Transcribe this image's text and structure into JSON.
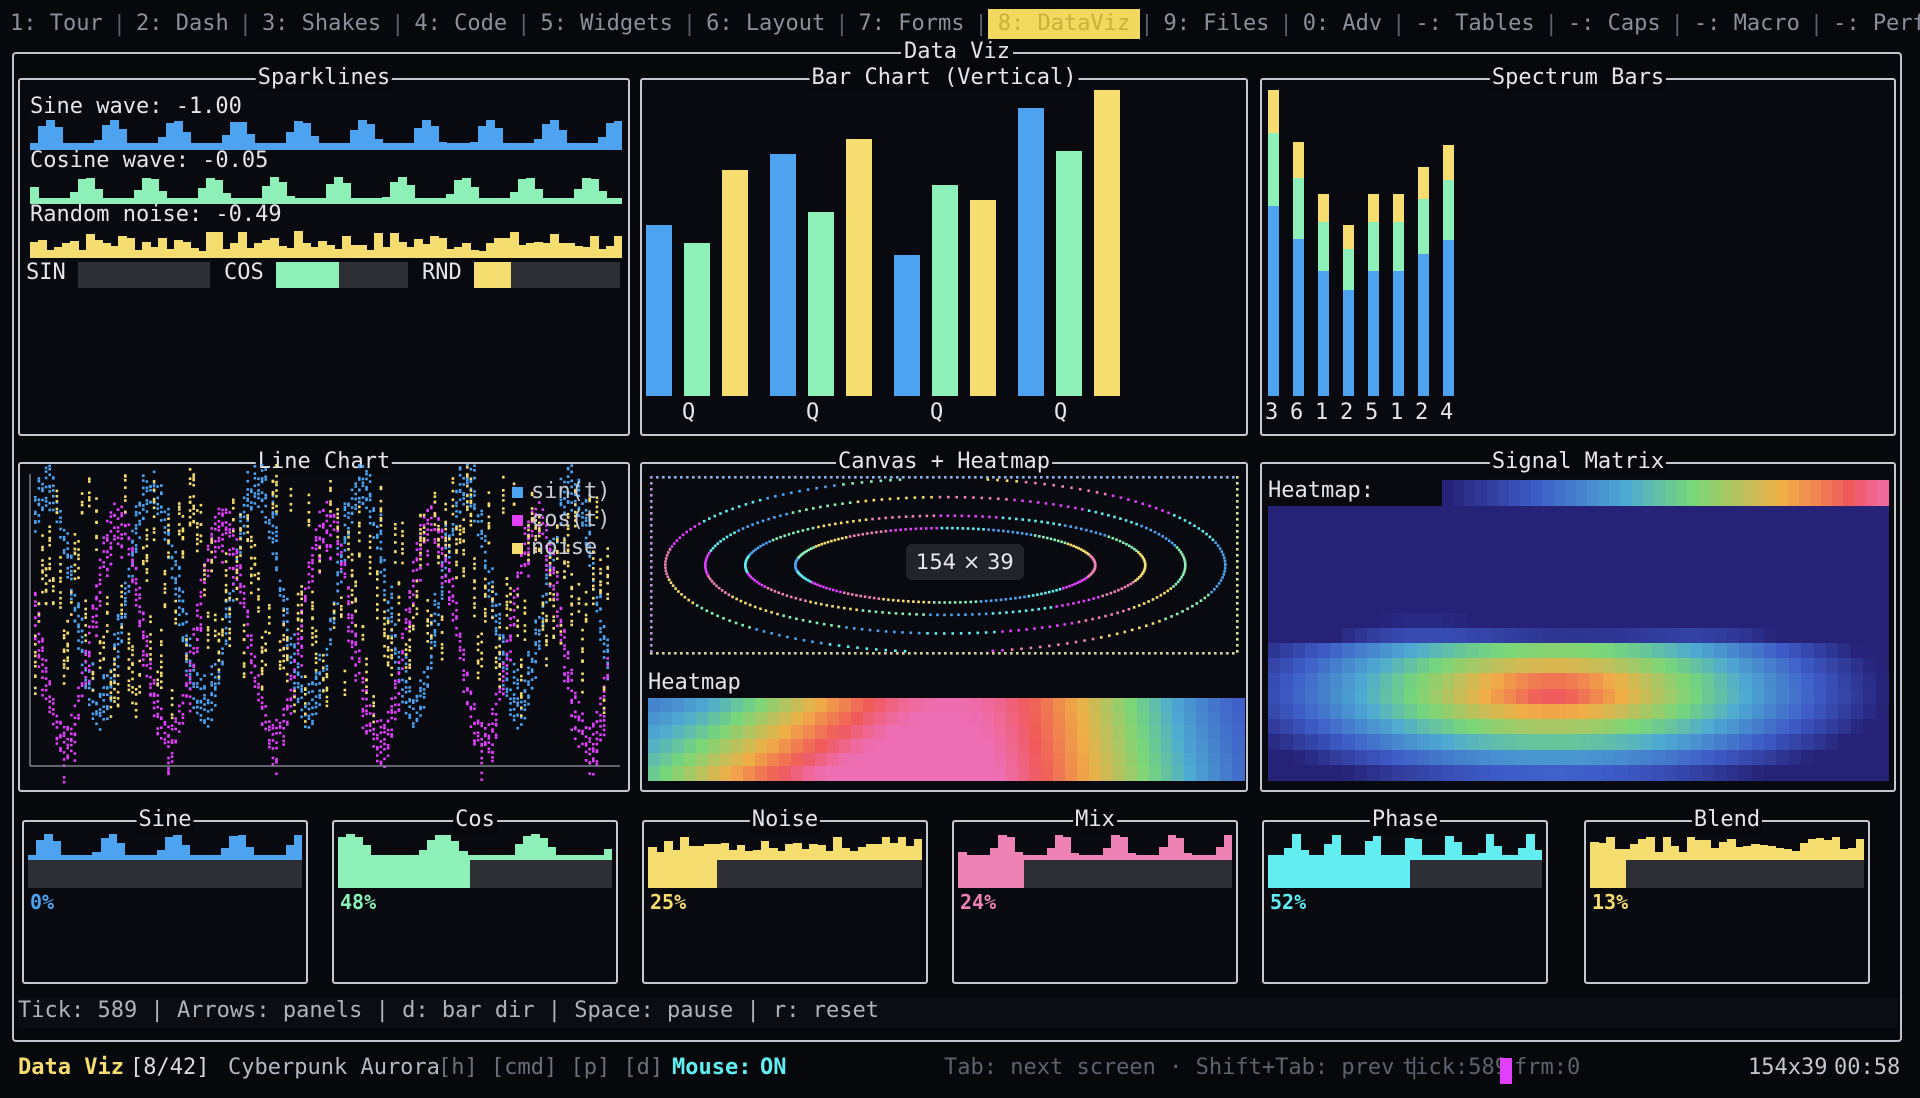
{
  "tabs": [
    {
      "label": "1: Tour",
      "active": false
    },
    {
      "label": "2: Dash",
      "active": false
    },
    {
      "label": "3: Shakes",
      "active": false
    },
    {
      "label": "4: Code",
      "active": false
    },
    {
      "label": "5: Widgets",
      "active": false
    },
    {
      "label": "6: Layout",
      "active": false
    },
    {
      "label": "7: Forms",
      "active": false
    },
    {
      "label": "8: DataViz",
      "active": true
    },
    {
      "label": "9: Files",
      "active": false
    },
    {
      "label": "0: Adv",
      "active": false
    },
    {
      "label": "-: Tables",
      "active": false
    },
    {
      "label": "-: Caps",
      "active": false
    },
    {
      "label": "-: Macro",
      "active": false
    },
    {
      "label": "-: Perf",
      "active": false
    }
  ],
  "screen_title": "Data Viz",
  "sparklines": {
    "title": "Sparklines",
    "sine_label": "Sine wave: -1.00",
    "cos_label": "Cosine wave: -0.05",
    "noise_label": "Random noise: -0.49",
    "gauge_sin": "SIN",
    "gauge_cos": "COS",
    "gauge_rnd": "RND",
    "gauge_sin_value": 0.0,
    "gauge_cos_value": 0.48,
    "gauge_rnd_value": 0.25
  },
  "bar_chart": {
    "title": "Bar Chart (Vertical)",
    "group_labels": [
      "Q",
      "Q",
      "Q",
      "Q"
    ],
    "values": [
      [
        0.56,
        0.5,
        0.74
      ],
      [
        0.79,
        0.6,
        0.84
      ],
      [
        0.46,
        0.69,
        0.64
      ],
      [
        0.94,
        0.8,
        1.0
      ]
    ]
  },
  "spectrum": {
    "title": "Spectrum Bars",
    "labels": [
      "3",
      "6",
      "1",
      "2",
      "5",
      "1",
      "2",
      "4"
    ],
    "values": [
      1.0,
      0.83,
      0.66,
      0.56,
      0.66,
      0.66,
      0.75,
      0.82
    ]
  },
  "line_chart": {
    "title": "Line Chart",
    "legend": [
      "sin(t)",
      "cos(t)",
      "noise"
    ]
  },
  "canvas": {
    "title": "Canvas + Heatmap",
    "tooltip": "154 × 39",
    "heatmap_label": "Heatmap"
  },
  "signal": {
    "title": "Signal Matrix",
    "heatmap_label": "Heatmap:"
  },
  "mini": [
    {
      "title": "Sine",
      "pct": "0%",
      "value": 0.0,
      "color": "#4da3f0"
    },
    {
      "title": "Cos",
      "pct": "48%",
      "value": 0.48,
      "color": "#8cf0b8"
    },
    {
      "title": "Noise",
      "pct": "25%",
      "value": 0.25,
      "color": "#f5dd70"
    },
    {
      "title": "Mix",
      "pct": "24%",
      "value": 0.24,
      "color": "#ee82b4"
    },
    {
      "title": "Phase",
      "pct": "52%",
      "value": 0.52,
      "color": "#62eef0"
    },
    {
      "title": "Blend",
      "pct": "13%",
      "value": 0.13,
      "color": "#f5dd70"
    }
  ],
  "status_line": "Tick: 589 | Arrows: panels | d: bar dir | Space: pause | r: reset",
  "bottom": {
    "screen": "Data Viz",
    "index": "[8/42]",
    "theme": "Cyberpunk Aurora",
    "keys": "[h] [cmd] [p] [d]",
    "mouse_label": "Mouse:",
    "mouse_state": "ON",
    "hint": "Tab: next screen · Shift+Tab: prev |",
    "tick": "tick:589",
    "frm": "frm:0",
    "size": "154x39",
    "time": "00:58"
  },
  "colors": {
    "blue": "#4da3f0",
    "green": "#8cf0b8",
    "yellow": "#f5dd70",
    "pink": "#ee82b4",
    "cyan": "#62eef0",
    "magenta": "#e040fb"
  }
}
